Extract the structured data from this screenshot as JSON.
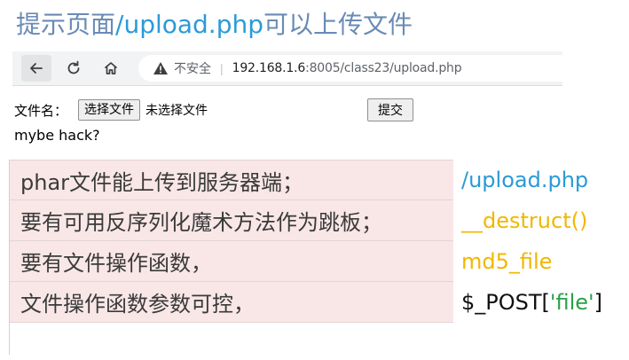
{
  "slide": {
    "title_prefix": "提示页面",
    "title_highlight": "/upload.php",
    "title_suffix": "可以上传文件"
  },
  "browser": {
    "back_icon": "arrow-left-icon",
    "reload_icon": "reload-icon",
    "home_icon": "home-icon",
    "warning_icon": "warning-triangle-icon",
    "insecure_label": "不安全",
    "separator": "|",
    "url_host": "192.168.1.6",
    "url_path": ":8005/class23/upload.php"
  },
  "form": {
    "file_label": "文件名：",
    "choose_button": "选择文件",
    "no_file_text": "未选择文件",
    "submit_button": "提交",
    "hack_text": "mybe hack?"
  },
  "conditions": [
    {
      "text": "phar文件能上传到服务器端；",
      "note": "/upload.php"
    },
    {
      "text": "要有可用反序列化魔术方法作为跳板；",
      "note": "__destruct()"
    },
    {
      "text": "要有文件操作函数，",
      "note": "md5_file"
    },
    {
      "text": "文件操作函数参数可控，",
      "note_prefix": "$_POST[",
      "note_quoted": "'file'",
      "note_suffix": "]"
    }
  ],
  "colors": {
    "title": "#6a8bb5",
    "title_highlight": "#2b9ad8",
    "table_bg": "#f9e7e7",
    "note_blue": "#2a9ad6",
    "note_yellow": "#f1b700",
    "note_green": "#2aa14a"
  }
}
